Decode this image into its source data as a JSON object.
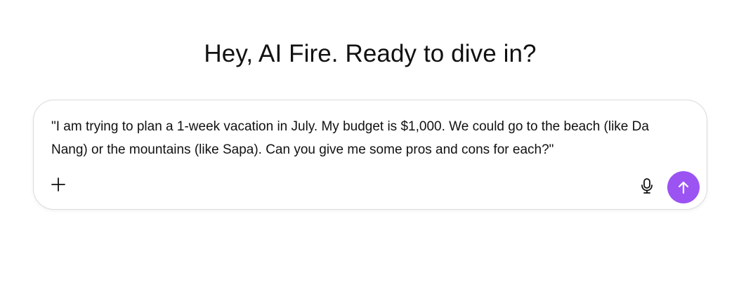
{
  "header": {
    "greeting": "Hey, AI Fire. Ready to dive in?"
  },
  "composer": {
    "prompt_value": "\"I am trying to plan a 1-week vacation in July. My budget is $1,000. We could go to the beach (like Da Nang) or the mountains (like Sapa). Can you give me some pros and cons for each?\"",
    "icons": {
      "add": "plus-icon",
      "mic": "microphone-icon",
      "send": "arrow-up-icon"
    },
    "colors": {
      "send_button": "#9b53f2",
      "border": "#dcdcdc"
    }
  }
}
